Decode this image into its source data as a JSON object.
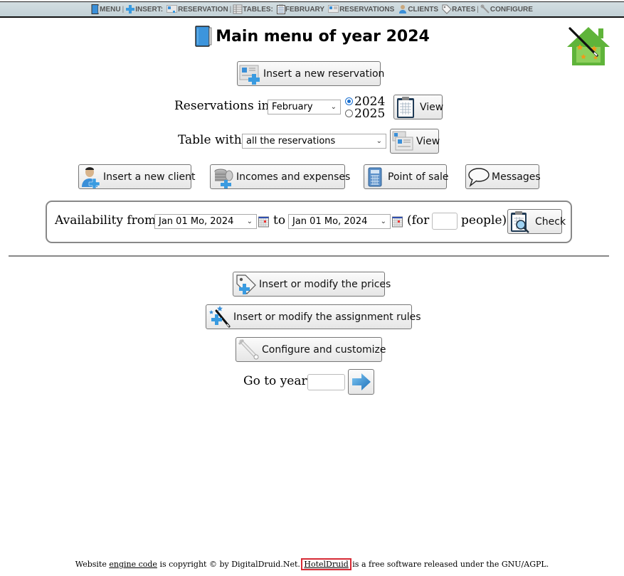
{
  "topbar": {
    "items": [
      {
        "label": "MENU",
        "icon": "book-icon"
      },
      {
        "label": "INSERT:",
        "icon": "plus-icon"
      },
      {
        "label": "RESERVATION",
        "icon": "reservation-card-icon"
      },
      {
        "label": "TABLES:",
        "icon": "table-icon"
      },
      {
        "label": "FEBRUARY",
        "icon": "calendar-icon"
      },
      {
        "label": "RESERVATIONS",
        "icon": "reservation-card-icon"
      },
      {
        "label": "CLIENTS",
        "icon": "client-icon"
      },
      {
        "label": "RATES",
        "icon": "price-tag-icon"
      },
      {
        "label": "CONFIGURE",
        "icon": "wrench-icon"
      }
    ]
  },
  "header": {
    "title": "Main menu of year 2024",
    "title_icon": "book-icon",
    "logo": "house-wand-logo"
  },
  "main": {
    "insert_reservation_label": "Insert a new reservation",
    "reservations_in": {
      "label": "Reservations in",
      "month_selected": "February",
      "years": [
        {
          "label": "2024",
          "checked": true
        },
        {
          "label": "2025",
          "checked": false
        }
      ],
      "view_label": "View"
    },
    "table_with": {
      "label": "Table with",
      "selected": "all the reservations",
      "view_label": "View"
    },
    "actions": [
      {
        "label": "Insert a new client",
        "icon": "client-add-icon"
      },
      {
        "label": "Incomes and expenses",
        "icon": "coins-icon"
      },
      {
        "label": "Point of sale",
        "icon": "calculator-icon"
      },
      {
        "label": "Messages",
        "icon": "speech-bubble-icon"
      }
    ],
    "availability": {
      "from_label": "Availability from",
      "from_value": "Jan 01 Mo, 2024",
      "to_label": "to",
      "to_value": "Jan 01 Mo, 2024",
      "for_label": "(for",
      "people_value": "",
      "people_label": "people)",
      "check_label": "Check"
    },
    "prices_label": "Insert or modify the prices",
    "rules_label": "Insert or modify the assignment rules",
    "configure_label": "Configure and customize",
    "goto_year": {
      "label": "Go to year",
      "value": ""
    }
  },
  "footer": {
    "prefix": "Website",
    "engine_link": "engine code",
    "middle": "is copyright © by DigitalDruid.Net.",
    "product_link": "HotelDruid",
    "suffix": "is a free software released under the GNU/AGPL."
  },
  "colors": {
    "topbar_bg": "#c8d6db",
    "highlight": "#d62b35",
    "accent_blue": "#1a6fd0",
    "logo_green": "#5fb43a"
  }
}
